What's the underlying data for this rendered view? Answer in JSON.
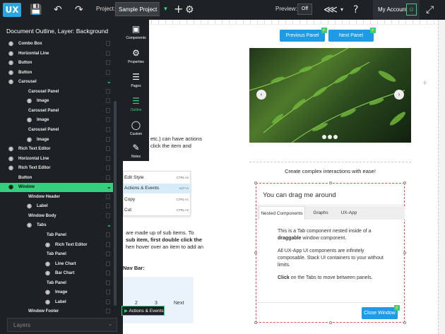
{
  "topbar": {
    "logo_text": "UX",
    "project_label": "Project:",
    "project_value": "Sample Project",
    "preview_label": "Preview:",
    "preview_value": "Off",
    "account_label": "My Account"
  },
  "left_panel": {
    "title": "Document Outline, Layer: Background",
    "rows": [
      {
        "label": "Combo Box"
      },
      {
        "label": "Horizontal Line"
      },
      {
        "label": "Button"
      },
      {
        "label": "Button"
      },
      {
        "label": "Carousel"
      },
      {
        "label": "Carousel Panel"
      },
      {
        "label": "Image"
      },
      {
        "label": "Carousel Panel"
      },
      {
        "label": "Image"
      },
      {
        "label": "Carousel Panel"
      },
      {
        "label": "Image"
      },
      {
        "label": "Rich Text Editor"
      },
      {
        "label": "Horizontal Line"
      },
      {
        "label": "Rich Text Editor"
      },
      {
        "label": "Button"
      },
      {
        "label": "Window"
      },
      {
        "label": "Window Header"
      },
      {
        "label": "Label"
      },
      {
        "label": "Window Body"
      },
      {
        "label": "Tabs"
      },
      {
        "label": "Tab Panel"
      },
      {
        "label": "Rich Text Editor"
      },
      {
        "label": "Tab Panel"
      },
      {
        "label": "Line Chart"
      },
      {
        "label": "Bar Chart"
      },
      {
        "label": "Tab Panel"
      },
      {
        "label": "Image"
      },
      {
        "label": "Label"
      },
      {
        "label": "Window Footer"
      }
    ],
    "layers_select": "Layers"
  },
  "rail": {
    "items": [
      {
        "label": "Components",
        "icon": "components-icon"
      },
      {
        "label": "Properties",
        "icon": "properties-icon"
      },
      {
        "label": "Pages",
        "icon": "pages-icon"
      },
      {
        "label": "Outline",
        "icon": "outline-icon"
      },
      {
        "label": "Custom",
        "icon": "custom-icon"
      },
      {
        "label": "Notes",
        "icon": "notes-icon"
      }
    ]
  },
  "canvas": {
    "text_frag_1": "etc.) can have actions",
    "text_frag_2": "click the item and",
    "text_frag_3": "are made up of sub items. To",
    "text_frag_4": "sub item, first double click the",
    "text_frag_5": "hen hover over an item to add an",
    "text_frag_6": "Nav Bar:",
    "context_menu": [
      {
        "label": "Edit Style",
        "shortcut": "CTRL+S"
      },
      {
        "label": "Actions & Events",
        "shortcut": "ALT+A"
      },
      {
        "label": "Copy",
        "shortcut": "CTRL+C"
      },
      {
        "label": "Cut",
        "shortcut": "CTRL+X"
      }
    ],
    "nav_mini_cells": [
      "2",
      "3",
      "Next"
    ],
    "actions_events_handle": "Actions & Events",
    "prev_button": "Previous Panel",
    "next_button": "Next Panel",
    "badge_glyph": "⚡",
    "subheading": "Create complex interactions with ease!",
    "window": {
      "title": "You can drag me around",
      "tabs": [
        "Nested Components",
        "Graphs",
        "UX-App"
      ],
      "para1_a": "This is a Tab component nested inside of a",
      "para1_b": "draggable",
      "para1_c": "window component.",
      "para2": "All UX-App UI components are infinitely composable. Stack UI containers to your without limits.",
      "para3_a": "Click",
      "para3_b": "on the Tabs to move between panels.",
      "close_button": "Close Window"
    }
  },
  "colors": {
    "accent_green": "#35d07f",
    "brand_blue": "#1e9be6",
    "dark_panel": "#1d2025"
  }
}
